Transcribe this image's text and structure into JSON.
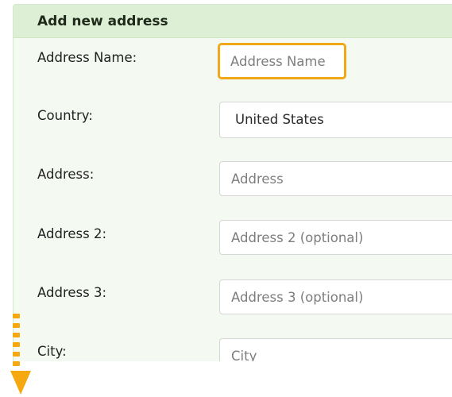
{
  "form": {
    "title": "Add new address",
    "fields": {
      "address_name": {
        "label": "Address Name:",
        "placeholder": "Address Name",
        "value": ""
      },
      "country": {
        "label": "Country:",
        "value": "United States"
      },
      "address": {
        "label": "Address:",
        "placeholder": "Address",
        "value": ""
      },
      "address2": {
        "label": "Address 2:",
        "placeholder": "Address 2 (optional)",
        "value": ""
      },
      "address3": {
        "label": "Address 3:",
        "placeholder": "Address 3 (optional)",
        "value": ""
      },
      "city": {
        "label": "City:",
        "placeholder": "City",
        "value": ""
      }
    }
  },
  "colors": {
    "panel_bg": "#f4faf1",
    "header_bg": "#ddf0d5",
    "focus_border": "#f0a818",
    "indicator": "#f5a80f"
  },
  "icons": {
    "scroll_indicator": "dotted-arrow-down-icon"
  }
}
